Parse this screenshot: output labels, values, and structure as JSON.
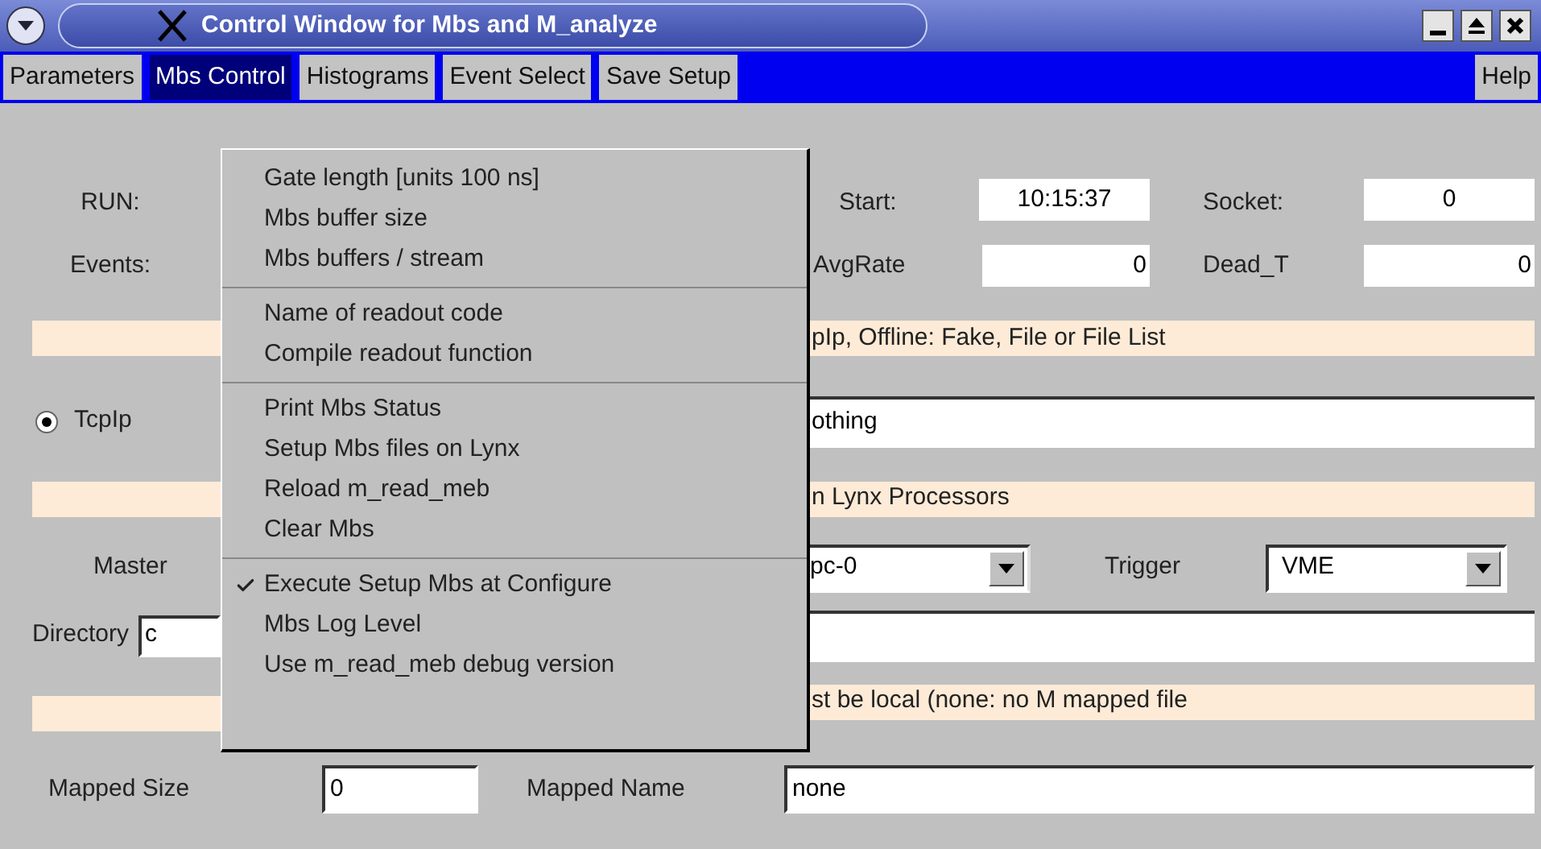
{
  "window": {
    "title": "Control Window for Mbs and M_analyze"
  },
  "menu_bar": [
    {
      "label": "Parameters",
      "selected": false
    },
    {
      "label": "Mbs Control",
      "selected": true
    },
    {
      "label": "Histograms",
      "selected": false
    },
    {
      "label": "Event Select",
      "selected": false
    },
    {
      "label": "Save Setup",
      "selected": false
    }
  ],
  "help_menu": {
    "label": "Help"
  },
  "dropdown_menu": {
    "groups": [
      [
        {
          "label": "Gate length [units 100 ns]",
          "checked": false
        },
        {
          "label": "Mbs buffer size",
          "checked": false
        },
        {
          "label": "Mbs buffers / stream",
          "checked": false
        }
      ],
      [
        {
          "label": "Name of readout code",
          "checked": false
        },
        {
          "label": "Compile readout function",
          "checked": false
        }
      ],
      [
        {
          "label": "Print Mbs Status",
          "checked": false
        },
        {
          "label": "Setup Mbs files on Lynx",
          "checked": false
        },
        {
          "label": "Reload m_read_meb",
          "checked": false
        },
        {
          "label": "Clear Mbs",
          "checked": false
        }
      ],
      [
        {
          "label": "Execute Setup Mbs at Configure",
          "checked": true
        },
        {
          "label": "Mbs Log Level",
          "checked": false
        },
        {
          "label": "Use m_read_meb debug version",
          "checked": false
        }
      ]
    ]
  },
  "form": {
    "run_label": "RUN:",
    "start_label": "Start:",
    "start_value": "10:15:37",
    "socket_label": "Socket:",
    "socket_value": "0",
    "events_label": "Events:",
    "avgrate_label": "AvgRate",
    "avgrate_value": "0",
    "dead_t_label": "Dead_T",
    "dead_t_value": "0",
    "mode_hint": "pIp, Offline: Fake, File or File List",
    "input_radio": {
      "label": "TcpIp",
      "selected": true
    },
    "input_source": "othing",
    "lynx_hint": "n Lynx Processors",
    "master_label": "Master",
    "master_select": "pc-0",
    "trigger_label": "Trigger",
    "trigger_select": "VME",
    "directory_label": "Directory",
    "directory_value": "c",
    "mapped_hint": "st be local (none: no M mapped file",
    "mapped_size_label": "Mapped Size",
    "mapped_size_value": "0",
    "mapped_name_label": "Mapped Name",
    "mapped_name_value": "none"
  }
}
